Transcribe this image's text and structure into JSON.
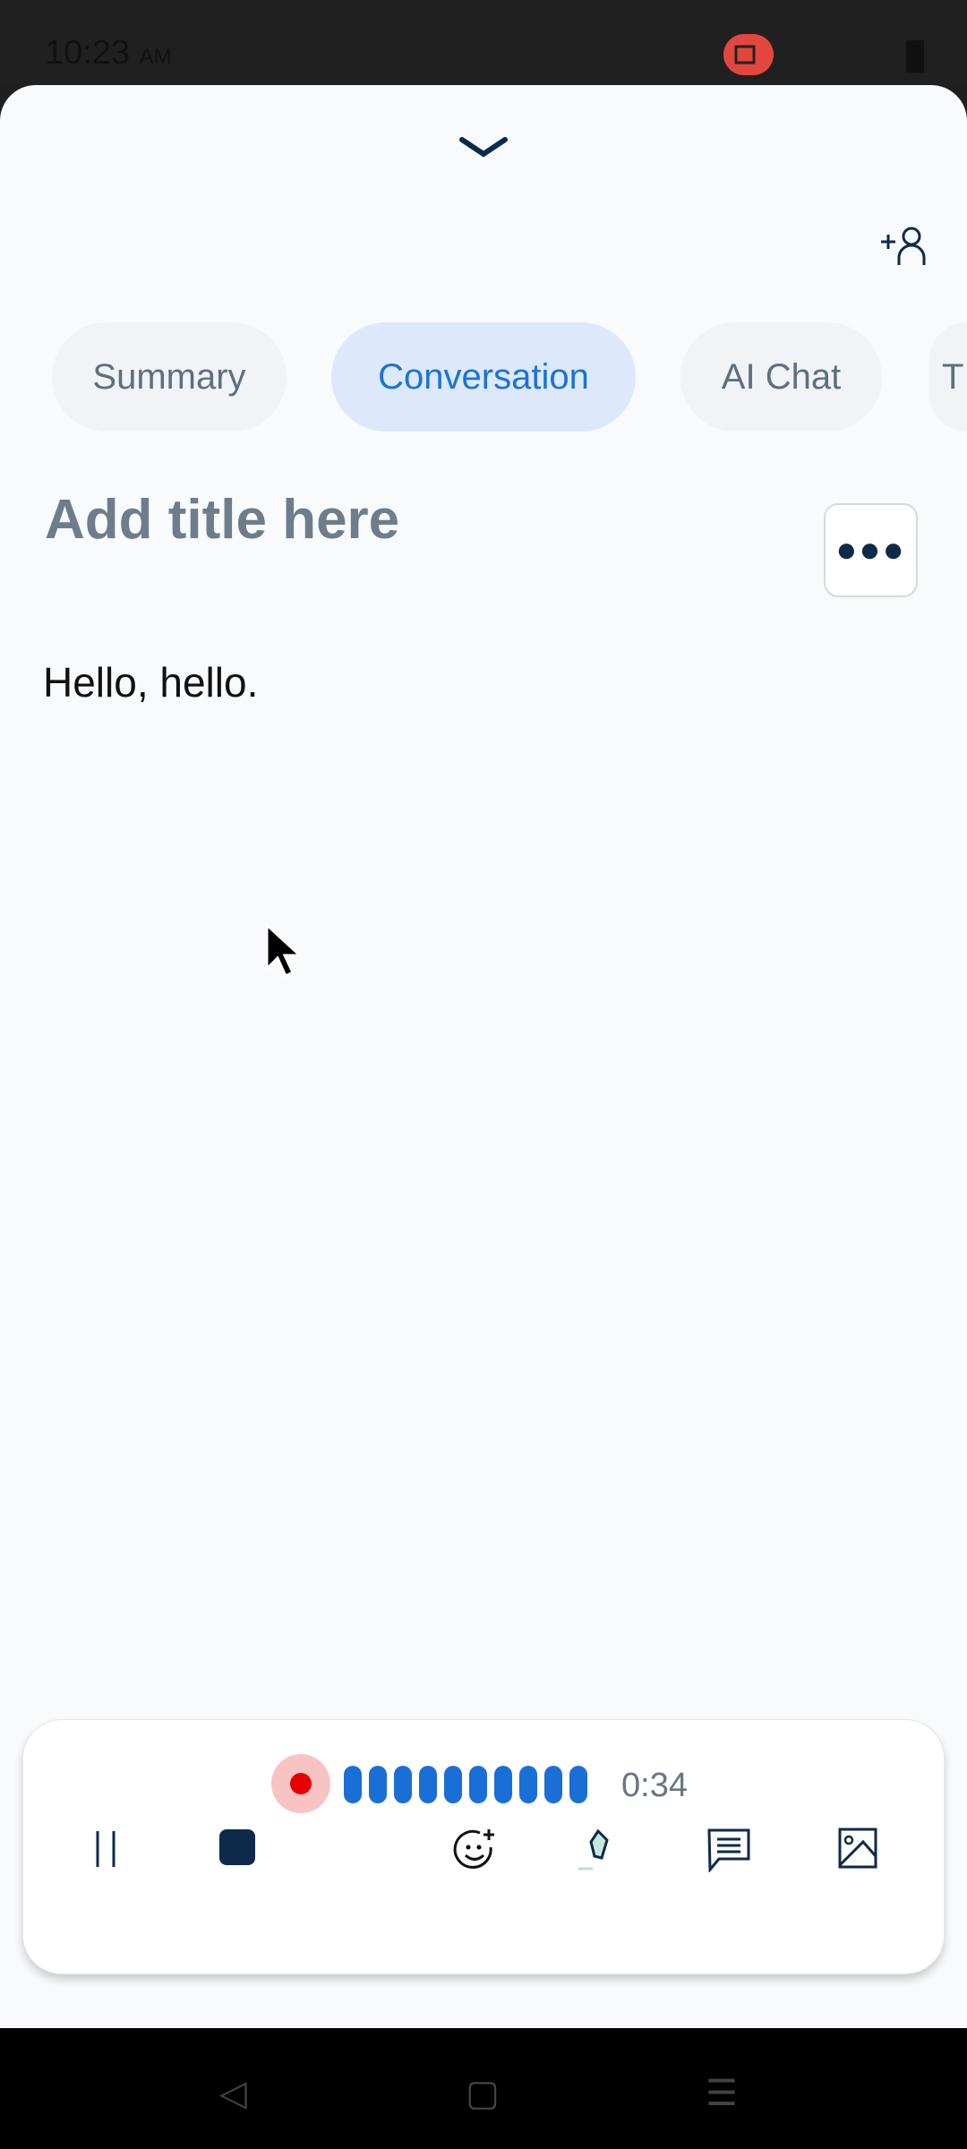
{
  "status_bar": {
    "time": "10:23",
    "ampm": "AM"
  },
  "tabs": [
    {
      "label": "Summary",
      "active": false
    },
    {
      "label": "Conversation",
      "active": true
    },
    {
      "label": "AI Chat",
      "active": false
    },
    {
      "label": "T",
      "active": false
    }
  ],
  "note": {
    "title_placeholder": "Add title here",
    "transcript": "Hello, hello."
  },
  "recorder": {
    "elapsed": "0:34",
    "state": "recording"
  },
  "colors": {
    "accent": "#1a73d8",
    "record": "#e60000",
    "icon": "#0d2a4a"
  }
}
